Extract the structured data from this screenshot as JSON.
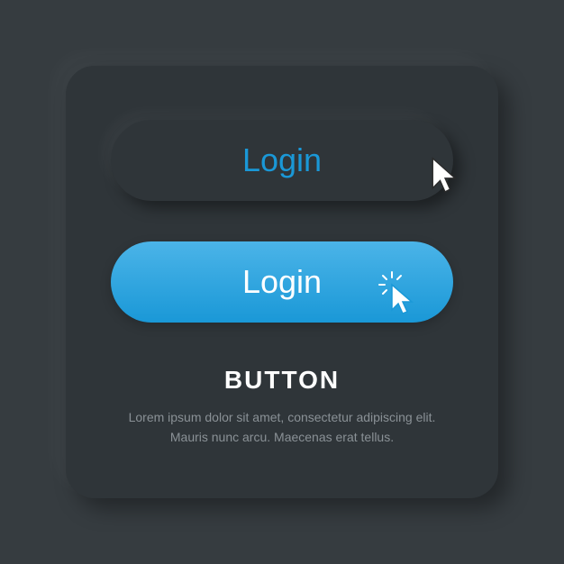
{
  "buttons": {
    "dark": {
      "label": "Login"
    },
    "blue": {
      "label": "Login"
    }
  },
  "heading": "BUTTON",
  "description": "Lorem ipsum dolor sit amet, consectetur adipiscing elit. Mauris nunc arcu. Maecenas erat tellus.",
  "colors": {
    "accent": "#1a98d7",
    "bg": "#363c40",
    "card": "#2f3539",
    "text_muted": "#8a9196"
  }
}
